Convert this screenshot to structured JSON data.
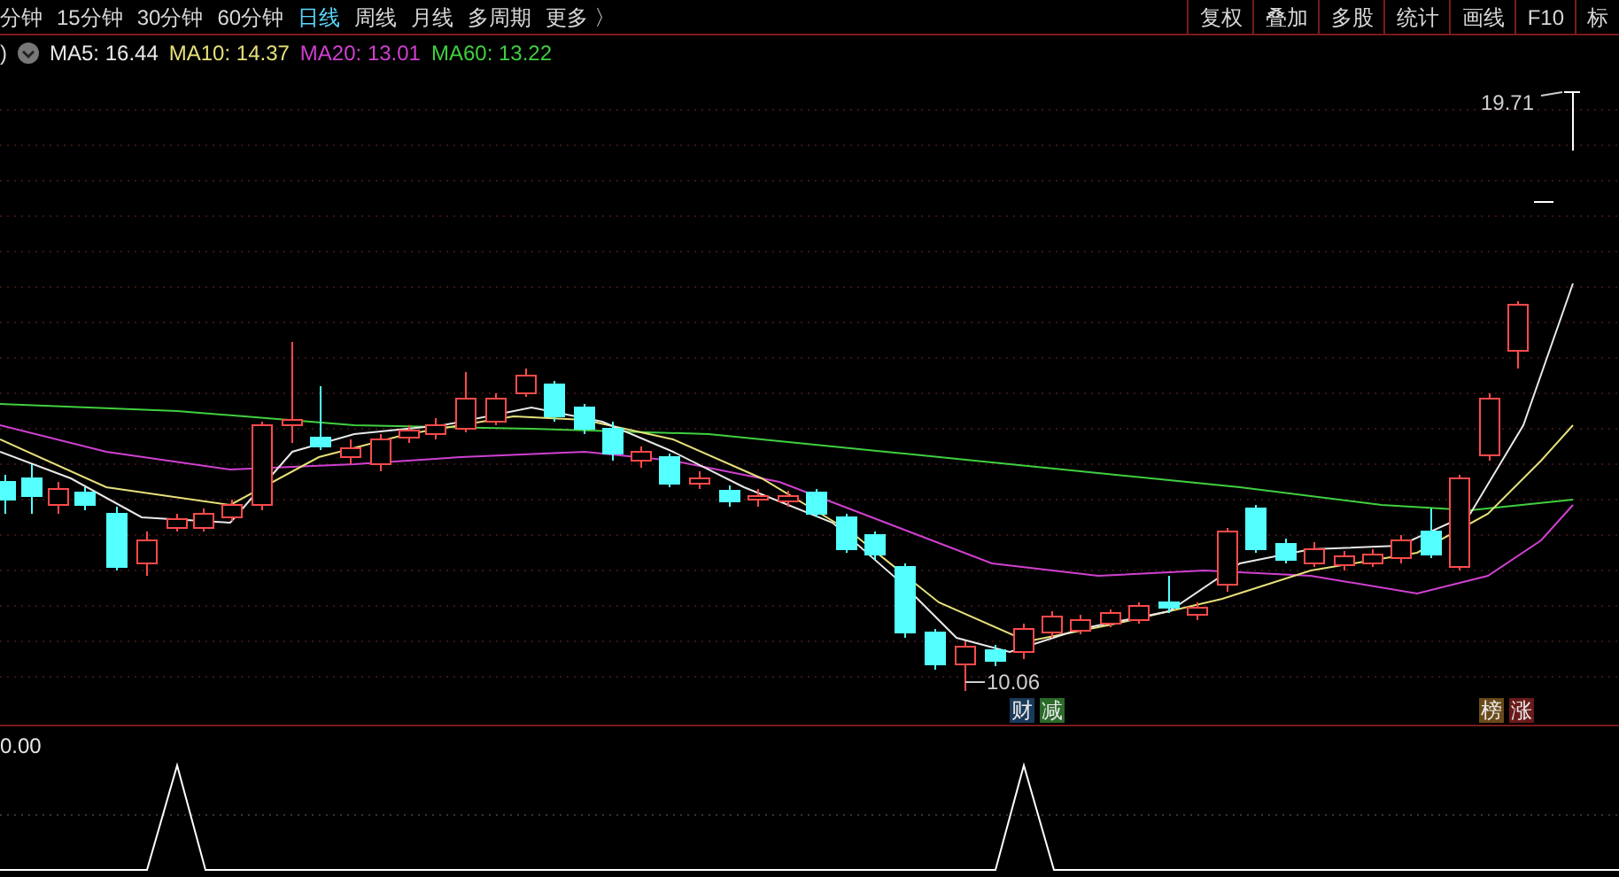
{
  "period_tabs": [
    {
      "label": "分钟",
      "selected": false
    },
    {
      "label": "15分钟",
      "selected": false
    },
    {
      "label": "30分钟",
      "selected": false
    },
    {
      "label": "60分钟",
      "selected": false
    },
    {
      "label": "日线",
      "selected": true
    },
    {
      "label": "周线",
      "selected": false
    },
    {
      "label": "月线",
      "selected": false
    },
    {
      "label": "多周期",
      "selected": false
    },
    {
      "label": "更多 〉",
      "selected": false
    }
  ],
  "toolbar_buttons": [
    "复权",
    "叠加",
    "多股",
    "统计",
    "画线",
    "F10",
    "标"
  ],
  "legend": {
    "prefix": ")",
    "items": [
      {
        "text": "MA5: 16.44",
        "color": "#e8e8e8"
      },
      {
        "text": "MA10: 14.37",
        "color": "#e6e07a"
      },
      {
        "text": "MA20: 13.01",
        "color": "#d040d0"
      },
      {
        "text": "MA60: 13.22",
        "color": "#40d040"
      }
    ]
  },
  "price_labels": {
    "high": "19.71",
    "low": "10.06"
  },
  "event_badges": [
    {
      "text": "财",
      "color": "#1a3a5a"
    },
    {
      "text": "减",
      "color": "#2a6a2a"
    },
    {
      "text": "榜",
      "color": "#6a4a1a"
    },
    {
      "text": "涨",
      "color": "#6a1a1a"
    }
  ],
  "lower_panel": {
    "value": "0.00"
  }
}
